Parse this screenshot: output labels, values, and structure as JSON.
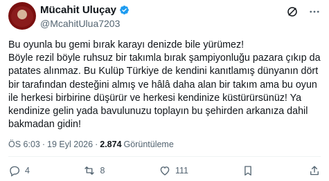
{
  "author": {
    "display_name": "Mücahit Uluçay",
    "handle": "@McahitUlua7203",
    "verified": true
  },
  "header_icons": [
    "grok-icon",
    "more-icon"
  ],
  "tweet": {
    "text": "Bu oyunla bu gemi bırak karayı denizde bile yürümez!\nBöyle rezil böyle ruhsuz bir takımla bırak şampiyonluğu pazara çıkıp da patates alınmaz. Bu Kulüp Türkiye de kendini kanıtlamış dünyanın dört bir tarafından desteğini almış ve hâlâ daha alan bir takım ama bu oyun ile herkesi birbirine düşürür ve herkesi kendinize küstürürsünüz! Ya kendinize gelin yada bavulunuzu toplayın bu şehirden arkanıza dahil bakmadan gidin!"
  },
  "meta": {
    "time": "ÖS 6:03",
    "separator": "·",
    "date": "19 Eyl 2026",
    "views_count": "2.874",
    "views_label": "Görüntüleme"
  },
  "actions": {
    "replies": "4",
    "reposts": "8",
    "likes": "111"
  },
  "colors": {
    "text": "#0f1419",
    "secondary": "#536471",
    "verified": "#1d9bf0",
    "divider": "#eff3f4"
  }
}
